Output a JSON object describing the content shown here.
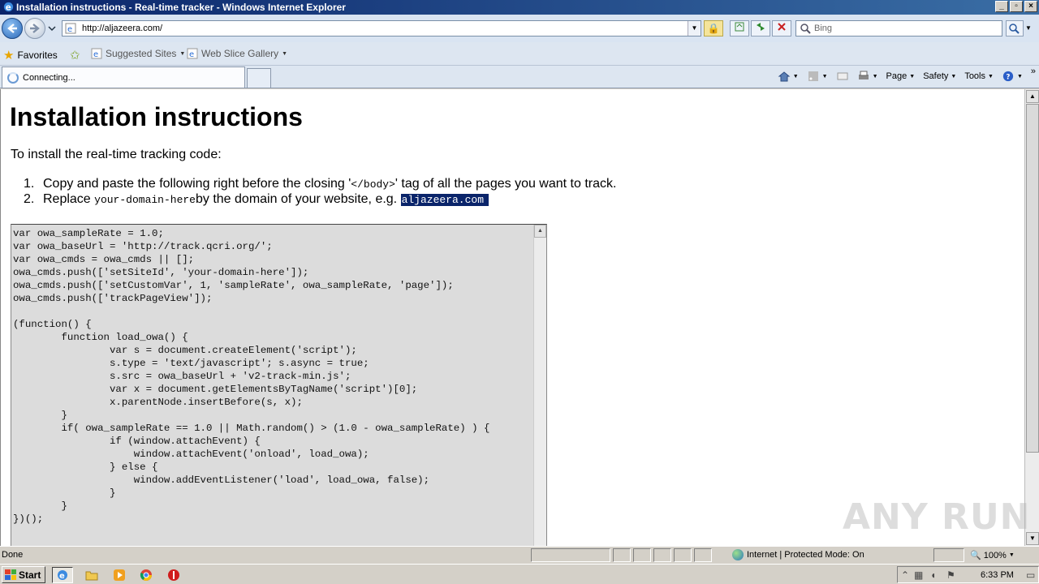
{
  "window": {
    "title": "Installation instructions - Real-time tracker - Windows Internet Explorer"
  },
  "nav": {
    "url": "http://aljazeera.com/",
    "search_placeholder": "Bing"
  },
  "favorites_bar": {
    "favorites_label": "Favorites",
    "items": [
      {
        "label": "Suggested Sites"
      },
      {
        "label": "Web Slice Gallery"
      }
    ]
  },
  "tabs": [
    {
      "label": "Connecting..."
    }
  ],
  "command_bar": {
    "page": "Page",
    "safety": "Safety",
    "tools": "Tools"
  },
  "page": {
    "heading": "Installation instructions",
    "intro": "To install the real-time tracking code:",
    "steps": [
      {
        "num": "1.",
        "pre": "Copy and paste the following right before the closing '",
        "code": "</body>",
        "post": "' tag of all the pages you want to track."
      },
      {
        "num": "2.",
        "pre": "Replace ",
        "code": "your-domain-here",
        "mid": " by the domain of your website, e.g. ",
        "highlight": "aljazeera.com"
      }
    ],
    "code": "var owa_sampleRate = 1.0;\nvar owa_baseUrl = 'http://track.qcri.org/';\nvar owa_cmds = owa_cmds || [];\nowa_cmds.push(['setSiteId', 'your-domain-here']);\nowa_cmds.push(['setCustomVar', 1, 'sampleRate', owa_sampleRate, 'page']);\nowa_cmds.push(['trackPageView']);\n\n(function() {\n        function load_owa() {\n                var s = document.createElement('script');\n                s.type = 'text/javascript'; s.async = true;\n                s.src = owa_baseUrl + 'v2-track-min.js';\n                var x = document.getElementsByTagName('script')[0];\n                x.parentNode.insertBefore(s, x);\n        }\n        if( owa_sampleRate == 1.0 || Math.random() > (1.0 - owa_sampleRate) ) {\n                if (window.attachEvent) {\n                    window.attachEvent('onload', load_owa);\n                } else {\n                    window.addEventListener('load', load_owa, false);\n                }\n        }\n})();"
  },
  "watermark": "ANY RUN",
  "status_bar": {
    "status": "Done",
    "zone": "Internet | Protected Mode: On",
    "zoom": "100%"
  },
  "taskbar": {
    "start": "Start",
    "clock": "6:33 PM"
  },
  "colors": {
    "selection": "#0a246a",
    "code_bg": "#dcdcdc",
    "titlebar": "#0a246a"
  }
}
